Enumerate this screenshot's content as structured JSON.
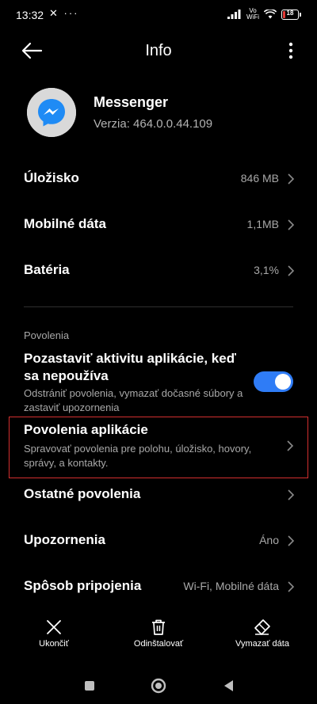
{
  "status_bar": {
    "time": "13:32",
    "left_icons": "✕ ···",
    "vowifi_top": "Vo",
    "vowifi_bottom": "WiFi",
    "battery_level": "18",
    "battery_fraction": 0.18,
    "battery_color": "#e53935"
  },
  "header": {
    "title": "Info"
  },
  "app": {
    "name": "Messenger",
    "version": "Verzia: 464.0.0.44.109",
    "icon": "messenger-icon"
  },
  "rows": {
    "storage": {
      "label": "Úložisko",
      "value": "846 MB"
    },
    "mobile_data": {
      "label": "Mobilné dáta",
      "value": "1,1MB"
    },
    "battery": {
      "label": "Batéria",
      "value": "3,1%"
    }
  },
  "permissions_section": {
    "label": "Povolenia",
    "pause_activity": {
      "title": "Pozastaviť aktivitu aplikácie, keď sa nepoužíva",
      "description": "Odstrániť povolenia, vymazať dočasné súbory a zastaviť upozornenia",
      "enabled": true
    },
    "app_permissions": {
      "title": "Povolenia aplikácie",
      "description": "Spravovať povolenia pre polohu, úložisko, hovory, správy, a kontakty."
    },
    "other_permissions": {
      "label": "Ostatné povolenia"
    },
    "notifications": {
      "label": "Upozornenia",
      "value": "Áno"
    },
    "connection": {
      "label": "Spôsob pripojenia",
      "value": "Wi-Fi, Mobilné dáta"
    }
  },
  "actions": {
    "force_stop": "Ukončiť",
    "uninstall": "Odinštalovať",
    "clear_data": "Vymazať dáta"
  },
  "colors": {
    "accent": "#2f7cf6",
    "highlight_border": "#d32f2f",
    "secondary_text": "#a8a8a8"
  }
}
